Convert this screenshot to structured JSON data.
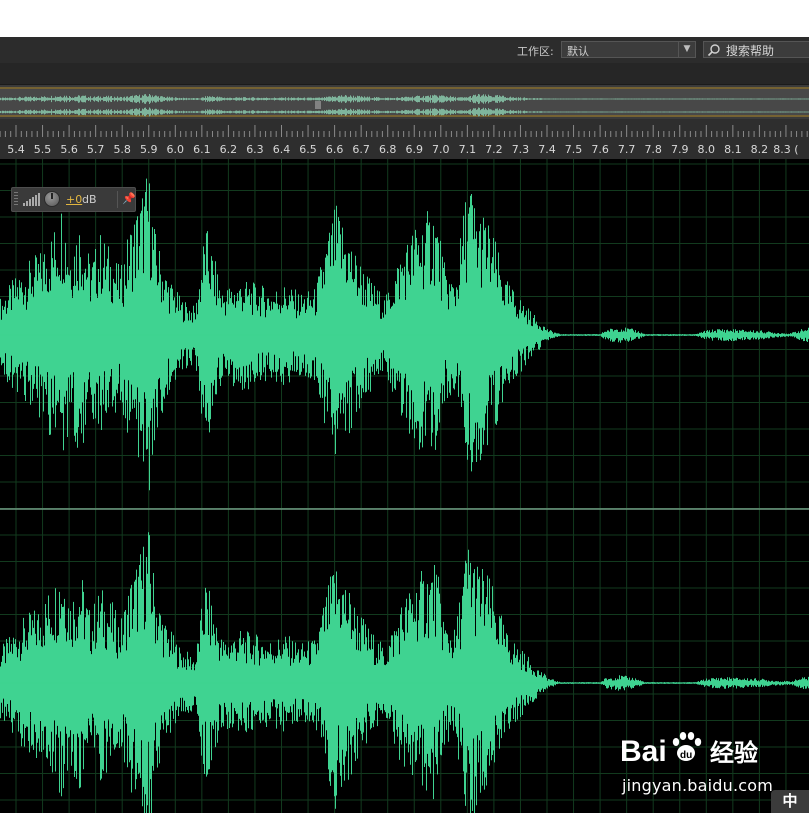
{
  "workspace": {
    "label": "工作区:",
    "selected": "默认",
    "help_search": "搜索帮助",
    "accent_color": "#3fd391"
  },
  "ruler": {
    "ticks": [
      "5.4",
      "5.5",
      "5.6",
      "5.7",
      "5.8",
      "5.9",
      "6.0",
      "6.1",
      "6.2",
      "6.3",
      "6.4",
      "6.5",
      "6.6",
      "6.7",
      "6.8",
      "6.9",
      "7.0",
      "7.1",
      "7.2",
      "7.3",
      "7.4",
      "7.5",
      "7.6",
      "7.7",
      "7.8",
      "7.9",
      "8.0",
      "8.1",
      "8.2",
      "8.3 ("
    ]
  },
  "hud": {
    "gain_value": "+0",
    "gain_unit": "dB",
    "icons": [
      "level-bars-icon",
      "volume-knob-icon",
      "pin-icon"
    ]
  },
  "watermark": {
    "brand": "Bai",
    "brand2": "du",
    "product": "经验",
    "url": "jingyan.baidu.com"
  },
  "ime": {
    "label": "中"
  }
}
